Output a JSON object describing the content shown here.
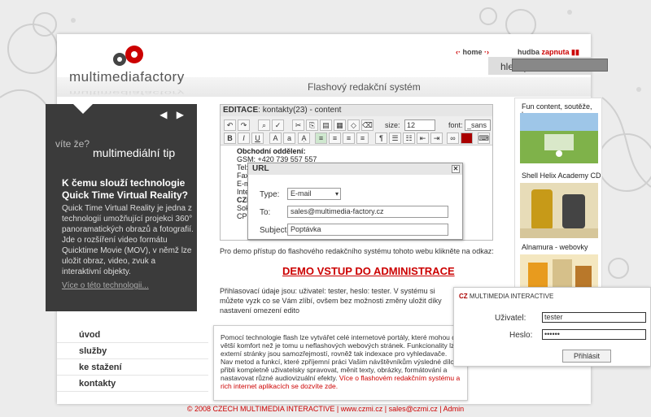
{
  "header": {
    "brand": "multimediafactory",
    "home_link": "home",
    "music_link": "hudba",
    "music_state": "zapnuta",
    "search_label": "hledej",
    "system_title": "Flashový redakční systém"
  },
  "tip": {
    "arrows": "◀ ▶",
    "kicker": "víte že?",
    "title": "multimediální tip",
    "question": "K čemu slouží technologie Quick Time Virtual Reality?",
    "body": "Quick Time Virtual Reality je jedna z technologií umožňující projekci 360° panoramatických obrazů a fotografií. Jde o rozšíření video formátu Quicktime Movie (MOV), v němž lze uložit obraz, video, zvuk a interaktivní objekty.",
    "more": "Více o této technologii..."
  },
  "nav": {
    "items": [
      "úvod",
      "služby",
      "ke stažení",
      "kontakty"
    ]
  },
  "editor": {
    "title_prefix": "EDITACE",
    "title": ": kontakty(23) - content",
    "size_label": "size:",
    "size_value": "12",
    "font_label": "font:",
    "font_value": "_sans",
    "body_lines": [
      "Obchodní oddělení:",
      "GSM:       +420 739 557 557",
      "Tel:",
      "Fax:",
      "",
      "E-m",
      "Inte",
      "",
      "CZE",
      "Sok",
      "CP"
    ]
  },
  "url_dialog": {
    "title": "URL",
    "type_label": "Type:",
    "type_value": "E-mail",
    "to_label": "To:",
    "to_value": "sales@multimedia-factory.cz",
    "subject_label": "Subject:",
    "subject_value": "Poptávka"
  },
  "content": {
    "intro": "Pro demo přístup do flashového redakčního systému tohoto webu klikněte na odkaz:",
    "demo_link": "DEMO VSTUP DO ADMINISTRACE",
    "credentials": "Přihlasovací údaje jsou: uživatel: tester, heslo: tester. V systému si můžete vyzk co se Vám zlíbí, ovšem bez možnosti změny uložit díky nastavení omezení edito"
  },
  "sidebar": {
    "items": [
      "Fun content, soutěže, hry",
      "Shell Helix Academy CD",
      "Alnamura - webovky"
    ]
  },
  "bottom": {
    "text": "Pomocí technologie flash lze vytvářet celé internetové portály, které mohou díl větší komfort než je tomu u neflashových webových stránek. Funkcionality lze externí stránky jsou samozřejmostí, rovněž tak indexace pro vyhledavače. Nav metod a funkcí, které zpříjemní práci Vašim návštěvníkům výsledné dílo přibli kompletně uživatelsky spravovat, měnit texty, obrázky, formátování a nastavovat různé audiovizuální efekty.",
    "link": "Více o flashovém redakčním systému a rich internet aplikacích se dozvíte zde."
  },
  "login": {
    "brand": "CZ",
    "brand_sub": "MULTIMEDIA INTERACTIVE",
    "user_label": "Uživatel:",
    "user_value": "tester",
    "pass_label": "Heslo:",
    "pass_value": "••••••",
    "submit": "Přihlásit"
  },
  "footer": {
    "text": "© 2008 CZECH MULTIMEDIA INTERACTIVE | www.czmi.cz | sales@czmi.cz | Admin"
  }
}
